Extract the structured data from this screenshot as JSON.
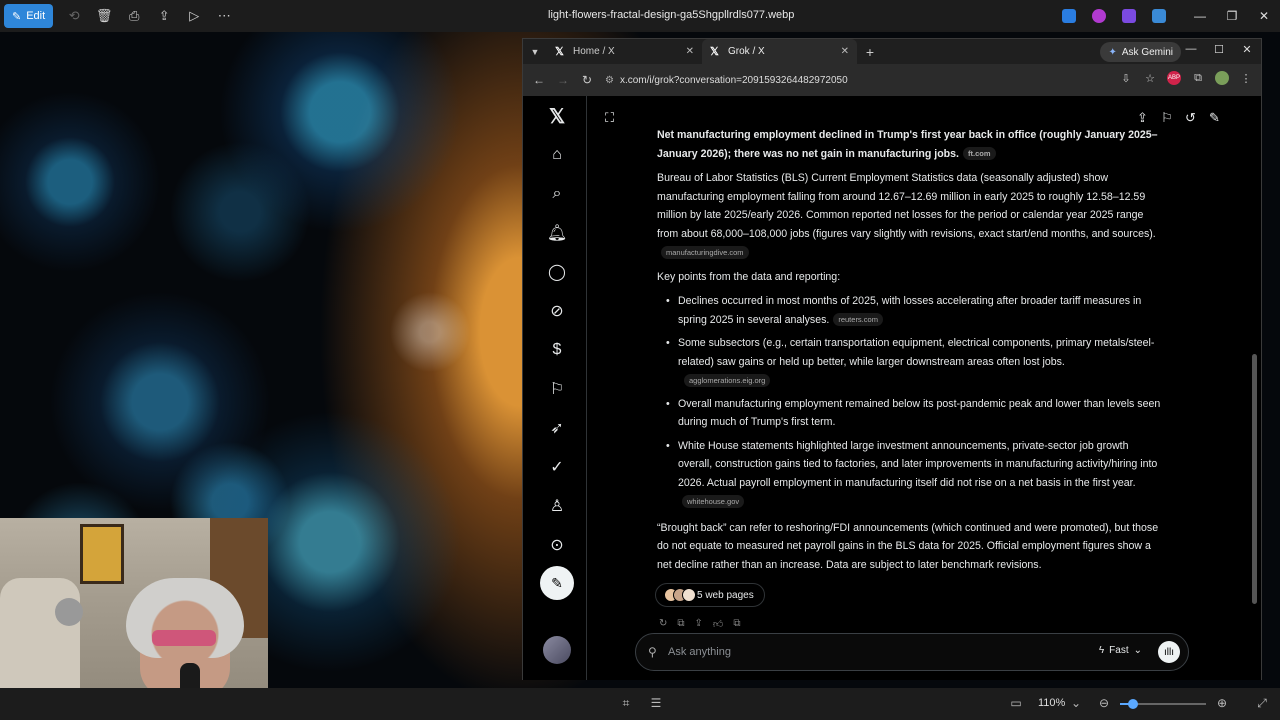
{
  "viewer": {
    "edit_label": "Edit",
    "file_title": "light-flowers-fractal-design-ga5Shgpllrdls077.webp",
    "zoom_level": "110%",
    "zoom_fraction": 0.15
  },
  "browser": {
    "tabs": [
      {
        "title": "Home / X",
        "active": false
      },
      {
        "title": "Grok / X",
        "active": true
      }
    ],
    "ask_gemini": "Ask Gemini",
    "url": "x.com/i/grok?conversation=2091593264482972050"
  },
  "grok": {
    "heading": "Net manufacturing employment declined in Trump's first year back in office (roughly January 2025–January 2026); there was no net gain in manufacturing jobs.",
    "heading_src": "ft.com",
    "para1": "Bureau of Labor Statistics (BLS) Current Employment Statistics data (seasonally adjusted) show manufacturing employment falling from around 12.67–12.69 million in early 2025 to roughly 12.58–12.59 million by late 2025/early 2026. Common reported net losses for the period or calendar year 2025 range from about 68,000–108,000 jobs (figures vary slightly with revisions, exact start/end months, and sources).",
    "para1_src": "manufacturingdive.com",
    "key_points_label": "Key points from the data and reporting:",
    "bullets": [
      {
        "text": "Declines occurred in most months of 2025, with losses accelerating after broader tariff measures in spring 2025 in several analyses.",
        "src": "reuters.com"
      },
      {
        "text": "Some subsectors (e.g., certain transportation equipment, electrical components, primary metals/steel-related) saw gains or held up better, while larger downstream areas often lost jobs.",
        "src": "agglomerations.eig.org"
      },
      {
        "text": "Overall manufacturing employment remained below its post-pandemic peak and lower than levels seen during much of Trump's first term.",
        "src": ""
      },
      {
        "text": "White House statements highlighted large investment announcements, private-sector job growth overall, construction gains tied to factories, and later improvements in manufacturing activity/hiring into 2026. Actual payroll employment in manufacturing itself did not rise on a net basis in the first year.",
        "src": "whitehouse.gov"
      }
    ],
    "closing": "“Brought back” can refer to reshoring/FDI announcements (which continued and were promoted), but those do not equate to measured net payroll gains in the BLS data for 2025. Official employment figures show a net decline rather than an increase. Data are subject to later benchmark revisions.",
    "web_pages": "5 web pages",
    "ask_placeholder": "Ask anything",
    "mode": "Fast"
  },
  "nav_icons": [
    "x-logo-icon",
    "home-icon",
    "search-icon",
    "notifications-icon",
    "messages-icon",
    "grok-icon",
    "premium-icon",
    "bookmarks-icon",
    "jobs-icon",
    "verified-icon",
    "profile-icon",
    "more-icon"
  ],
  "colors": {
    "edit_accent": "#2e86d9",
    "x_text": "#e7e9ea",
    "background": "#000000"
  }
}
